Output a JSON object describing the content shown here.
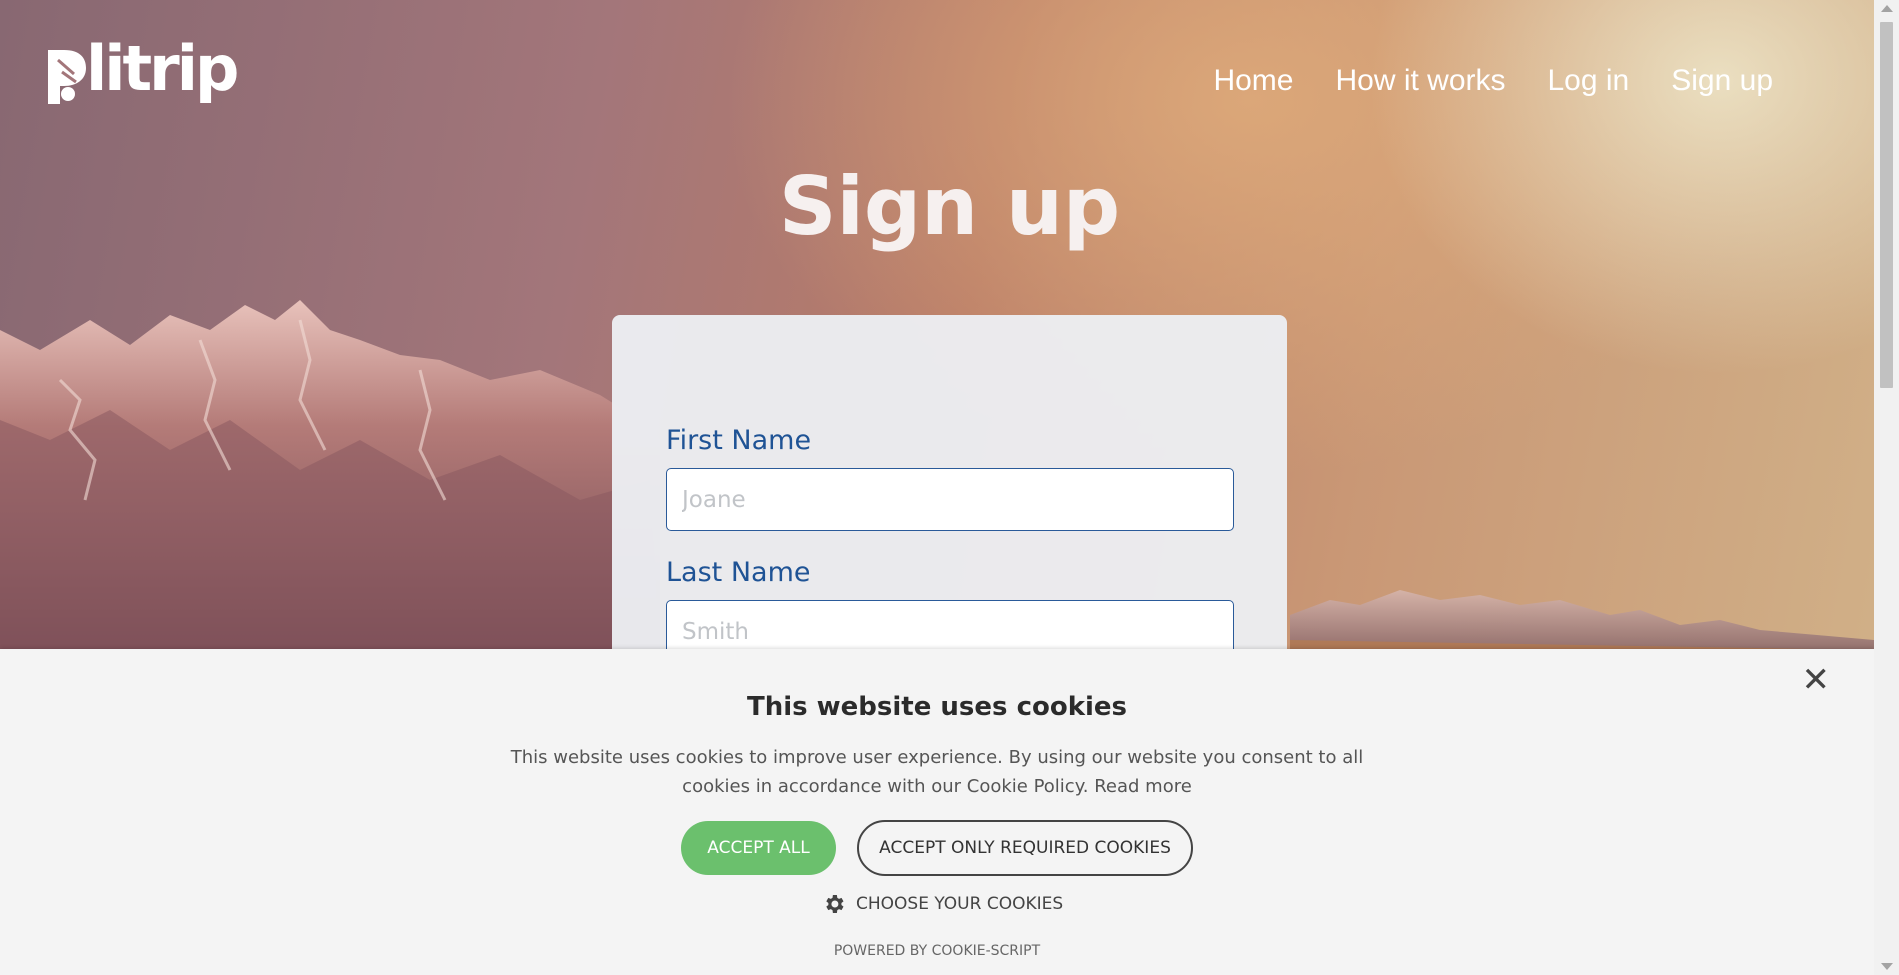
{
  "header": {
    "logo_text": "litrip",
    "nav": [
      {
        "label": "Home"
      },
      {
        "label": "How it works"
      },
      {
        "label": "Log in"
      },
      {
        "label": "Sign up"
      }
    ]
  },
  "main": {
    "title": "Sign up",
    "form": {
      "first_name": {
        "label": "First Name",
        "placeholder": "Joane",
        "value": ""
      },
      "last_name": {
        "label": "Last Name",
        "placeholder": "Smith",
        "value": ""
      }
    }
  },
  "cookie_banner": {
    "title": "This website uses cookies",
    "text": "This website uses cookies to improve user experience. By using our website you consent to all cookies in accordance with our Cookie Policy.",
    "read_more": "Read more",
    "accept_all": "ACCEPT ALL",
    "accept_required": "ACCEPT ONLY REQUIRED COOKIES",
    "choose": "CHOOSE YOUR COOKIES",
    "powered_by": "POWERED BY COOKIE-SCRIPT",
    "close_icon": "close-icon",
    "gear_icon": "gear-icon"
  },
  "colors": {
    "label_blue": "#1f5395",
    "accept_green": "#6bc06d",
    "banner_bg": "#f4f4f4"
  }
}
